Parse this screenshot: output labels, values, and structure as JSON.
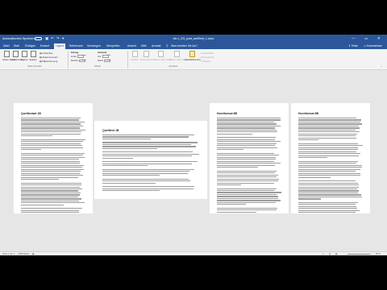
{
  "titlebar": {
    "autosave_label": "Automatisches Speichern",
    "autosave_state": "off",
    "undo_glyph": "↶",
    "redo_glyph": "↷",
    "title": "ullr-x_ZO_post_aoiiSmit_1.docx",
    "minimize_glyph": "—",
    "restore_glyph": "▭",
    "close_glyph": "✕"
  },
  "tabs": {
    "items": [
      "Datei",
      "Start",
      "Einfügen",
      "Entwurf",
      "Layout",
      "Referenzen",
      "Sendungen",
      "Überprüfen",
      "Ansicht",
      "Hilfe",
      "Acrobat",
      "Was möchten Sie tun?"
    ],
    "active_index": 4,
    "share_label": "Teilen",
    "comments_label": "Kommentare"
  },
  "ribbon": {
    "page_setup_buttons": [
      "Seiten-ränder",
      "Ausrich-tung",
      "Format",
      "Spalten"
    ],
    "page_setup_small": [
      "Umbrüche",
      "Zeilennummern",
      "Silbentrennung"
    ],
    "page_setup_group": "Seite einrichten",
    "indent_title": "Einzug",
    "indent_left": "Links:",
    "indent_left_value": "0 cm",
    "indent_right": "Rechts:",
    "indent_right_value": "0 cm",
    "spacing_title": "Abstand",
    "spacing_before": "Vor:",
    "spacing_before_value": "0 Pt.",
    "spacing_after": "Nach:",
    "spacing_after_value": "0 Pt.",
    "paragraph_group": "Absatz",
    "arrange_buttons": [
      "Position",
      "Textumbruch",
      "Ebene nach vorne",
      "Ebene nach hinten",
      "Auswahlbereich"
    ],
    "arrange_small": [
      "Ausrichten",
      "Gruppieren",
      "Drehen"
    ],
    "arrange_group": "Anordnen"
  },
  "pages": [
    {
      "heading": "Quelltextart 1B",
      "paragraphs": [
        10,
        6,
        14,
        12,
        10
      ]
    },
    {
      "heading": "Quelltext 1B",
      "paragraphs": [
        3,
        4,
        4,
        3,
        4,
        3,
        3
      ]
    },
    {
      "heading": "Hochformat 8B",
      "paragraphs": [
        9,
        7,
        8,
        8,
        9,
        3
      ]
    },
    {
      "heading": "Hochformat 8B",
      "paragraphs": [
        12,
        8,
        9,
        10,
        8,
        10
      ]
    }
  ],
  "status": {
    "page": "Seite 1 von 4",
    "words": "2156 Wörter",
    "zoom": "40 %"
  },
  "colors": {
    "word_blue": "#2b579a",
    "ribbon_bg": "#f3f3f3",
    "canvas_bg": "#e6e6e6",
    "letterbox": "#000000"
  }
}
